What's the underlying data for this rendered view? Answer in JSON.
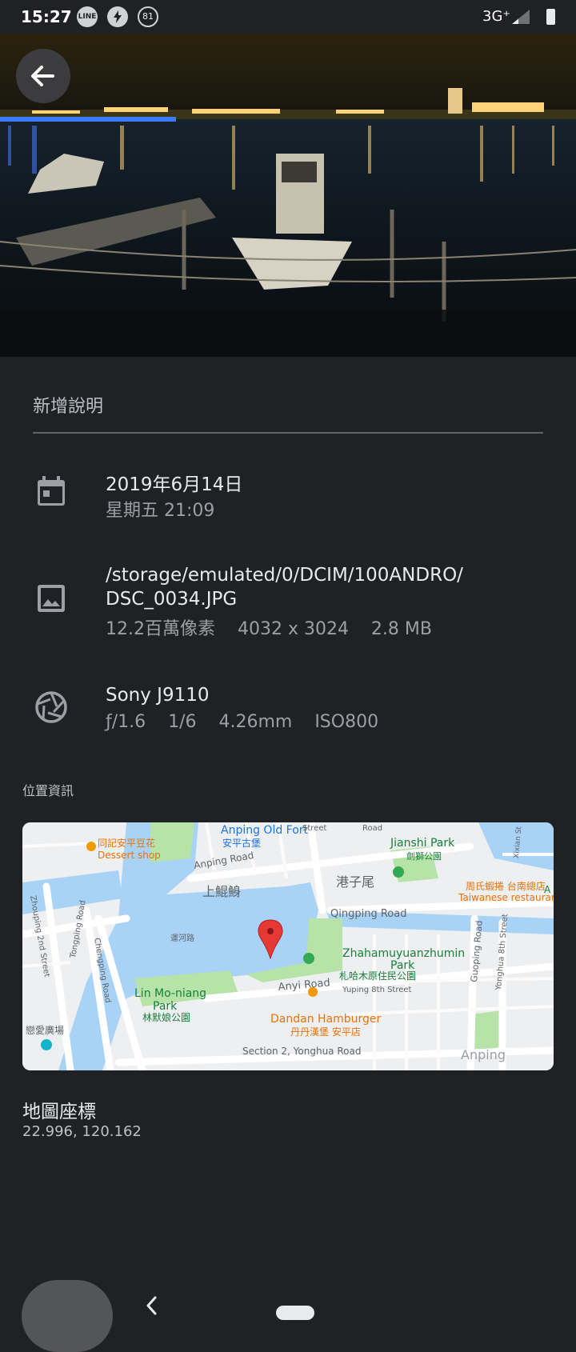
{
  "status_bar": {
    "time": "15:27",
    "icons": [
      "line-icon",
      "flash-icon"
    ],
    "line_label": "LINE",
    "battery_level": "81",
    "network": "3G⁺"
  },
  "photo": {
    "back_icon": "arrow-back-icon"
  },
  "caption": {
    "placeholder": "新增說明"
  },
  "details": {
    "date": {
      "icon": "calendar-icon",
      "title": "2019年6月14日",
      "sub": "星期五 21:09"
    },
    "file": {
      "icon": "image-icon",
      "path_line1": "/storage/emulated/0/DCIM/100ANDRO/",
      "path_line2": "DSC_0034.JPG",
      "sub": "12.2百萬像素    4032 x 3024    2.8 MB"
    },
    "camera": {
      "icon": "aperture-icon",
      "title": "Sony J9110",
      "sub": "ƒ/1.6    1/6    4.26mm    ISO800"
    }
  },
  "location": {
    "section_label": "位置資訊",
    "map_labels": {
      "anping_old_fort": "Anping Old Fort",
      "anping_old_fort_zh": "安平古堡",
      "street": "Street",
      "road": "Road",
      "anping_road": "Anping Road",
      "dessert_zh": "同記安平豆花",
      "dessert": "Dessert shop",
      "jianshi_park": "Jianshi Park",
      "jianshi_park_zh": "劍獅公園",
      "shangkunshen": "上鯤鯓",
      "gangziwei": "港子尾",
      "restaurant_zh": "周氏蝦捲 台南總店",
      "restaurant": "Taiwanese restaurant",
      "qingping_road": "Qingping Road",
      "zhongping_2nd": "Zhouping 2nd Street",
      "tongping_road": "Tongping Road",
      "chengping_road": "Chengping Road",
      "yunhe_road": "運河路",
      "zhaha_1": "Zhahamuyuanzhumin",
      "zhaha_2": "Park",
      "zhaha_zh": "札哈木原住民公園",
      "guoping_road": "Guoping Road",
      "yonghua_8th": "Yonghua 8th Street",
      "xixian": "Xixian St",
      "lin_moniang_1": "Lin Mo-niang",
      "lin_moniang_2": "Park",
      "lin_moniang_zh": "林默娘公園",
      "anyi_road": "Anyi Road",
      "yuping_8th": "Yuping 8th Street",
      "dandan": "Dandan Hamburger",
      "dandan_zh": "丹丹漢堡 安平店",
      "lianai": "戀愛廣場",
      "yonghua_road": "Section 2, Yonghua Road",
      "anping": "Anping",
      "a_edge": "A"
    },
    "map_pin_icon": "map-pin-icon",
    "coords_title": "地圖座標",
    "coords_value": "22.996, 120.162"
  },
  "colors": {
    "background": "#202124",
    "primary_text": "#e8eaed",
    "secondary_text": "#9aa0a6",
    "map_water": "#a9d2f7",
    "map_park": "#b5e3a8",
    "map_pin": "#e53935"
  }
}
